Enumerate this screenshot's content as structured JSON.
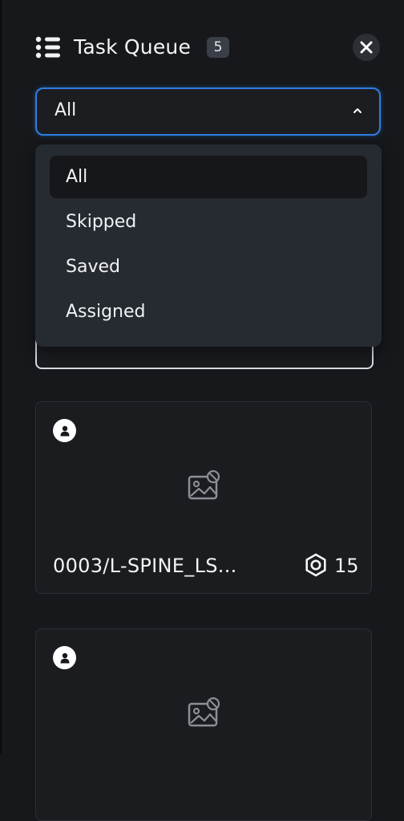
{
  "header": {
    "title": "Task Queue",
    "count": "5",
    "menu_icon": "list-icon",
    "close_icon": "close-icon"
  },
  "filter": {
    "selected": "All",
    "options": [
      "All",
      "Skipped",
      "Saved",
      "Assigned"
    ],
    "accent_color": "#2f7de0"
  },
  "cards": [
    {
      "name": "0003/L-SPINE_LS...",
      "count": "15",
      "user_icon": "user-icon",
      "thumb_icon": "image-placeholder-icon",
      "count_icon": "hexagon-icon"
    },
    {
      "name": "",
      "count": "",
      "user_icon": "user-icon",
      "thumb_icon": "image-placeholder-icon"
    }
  ]
}
